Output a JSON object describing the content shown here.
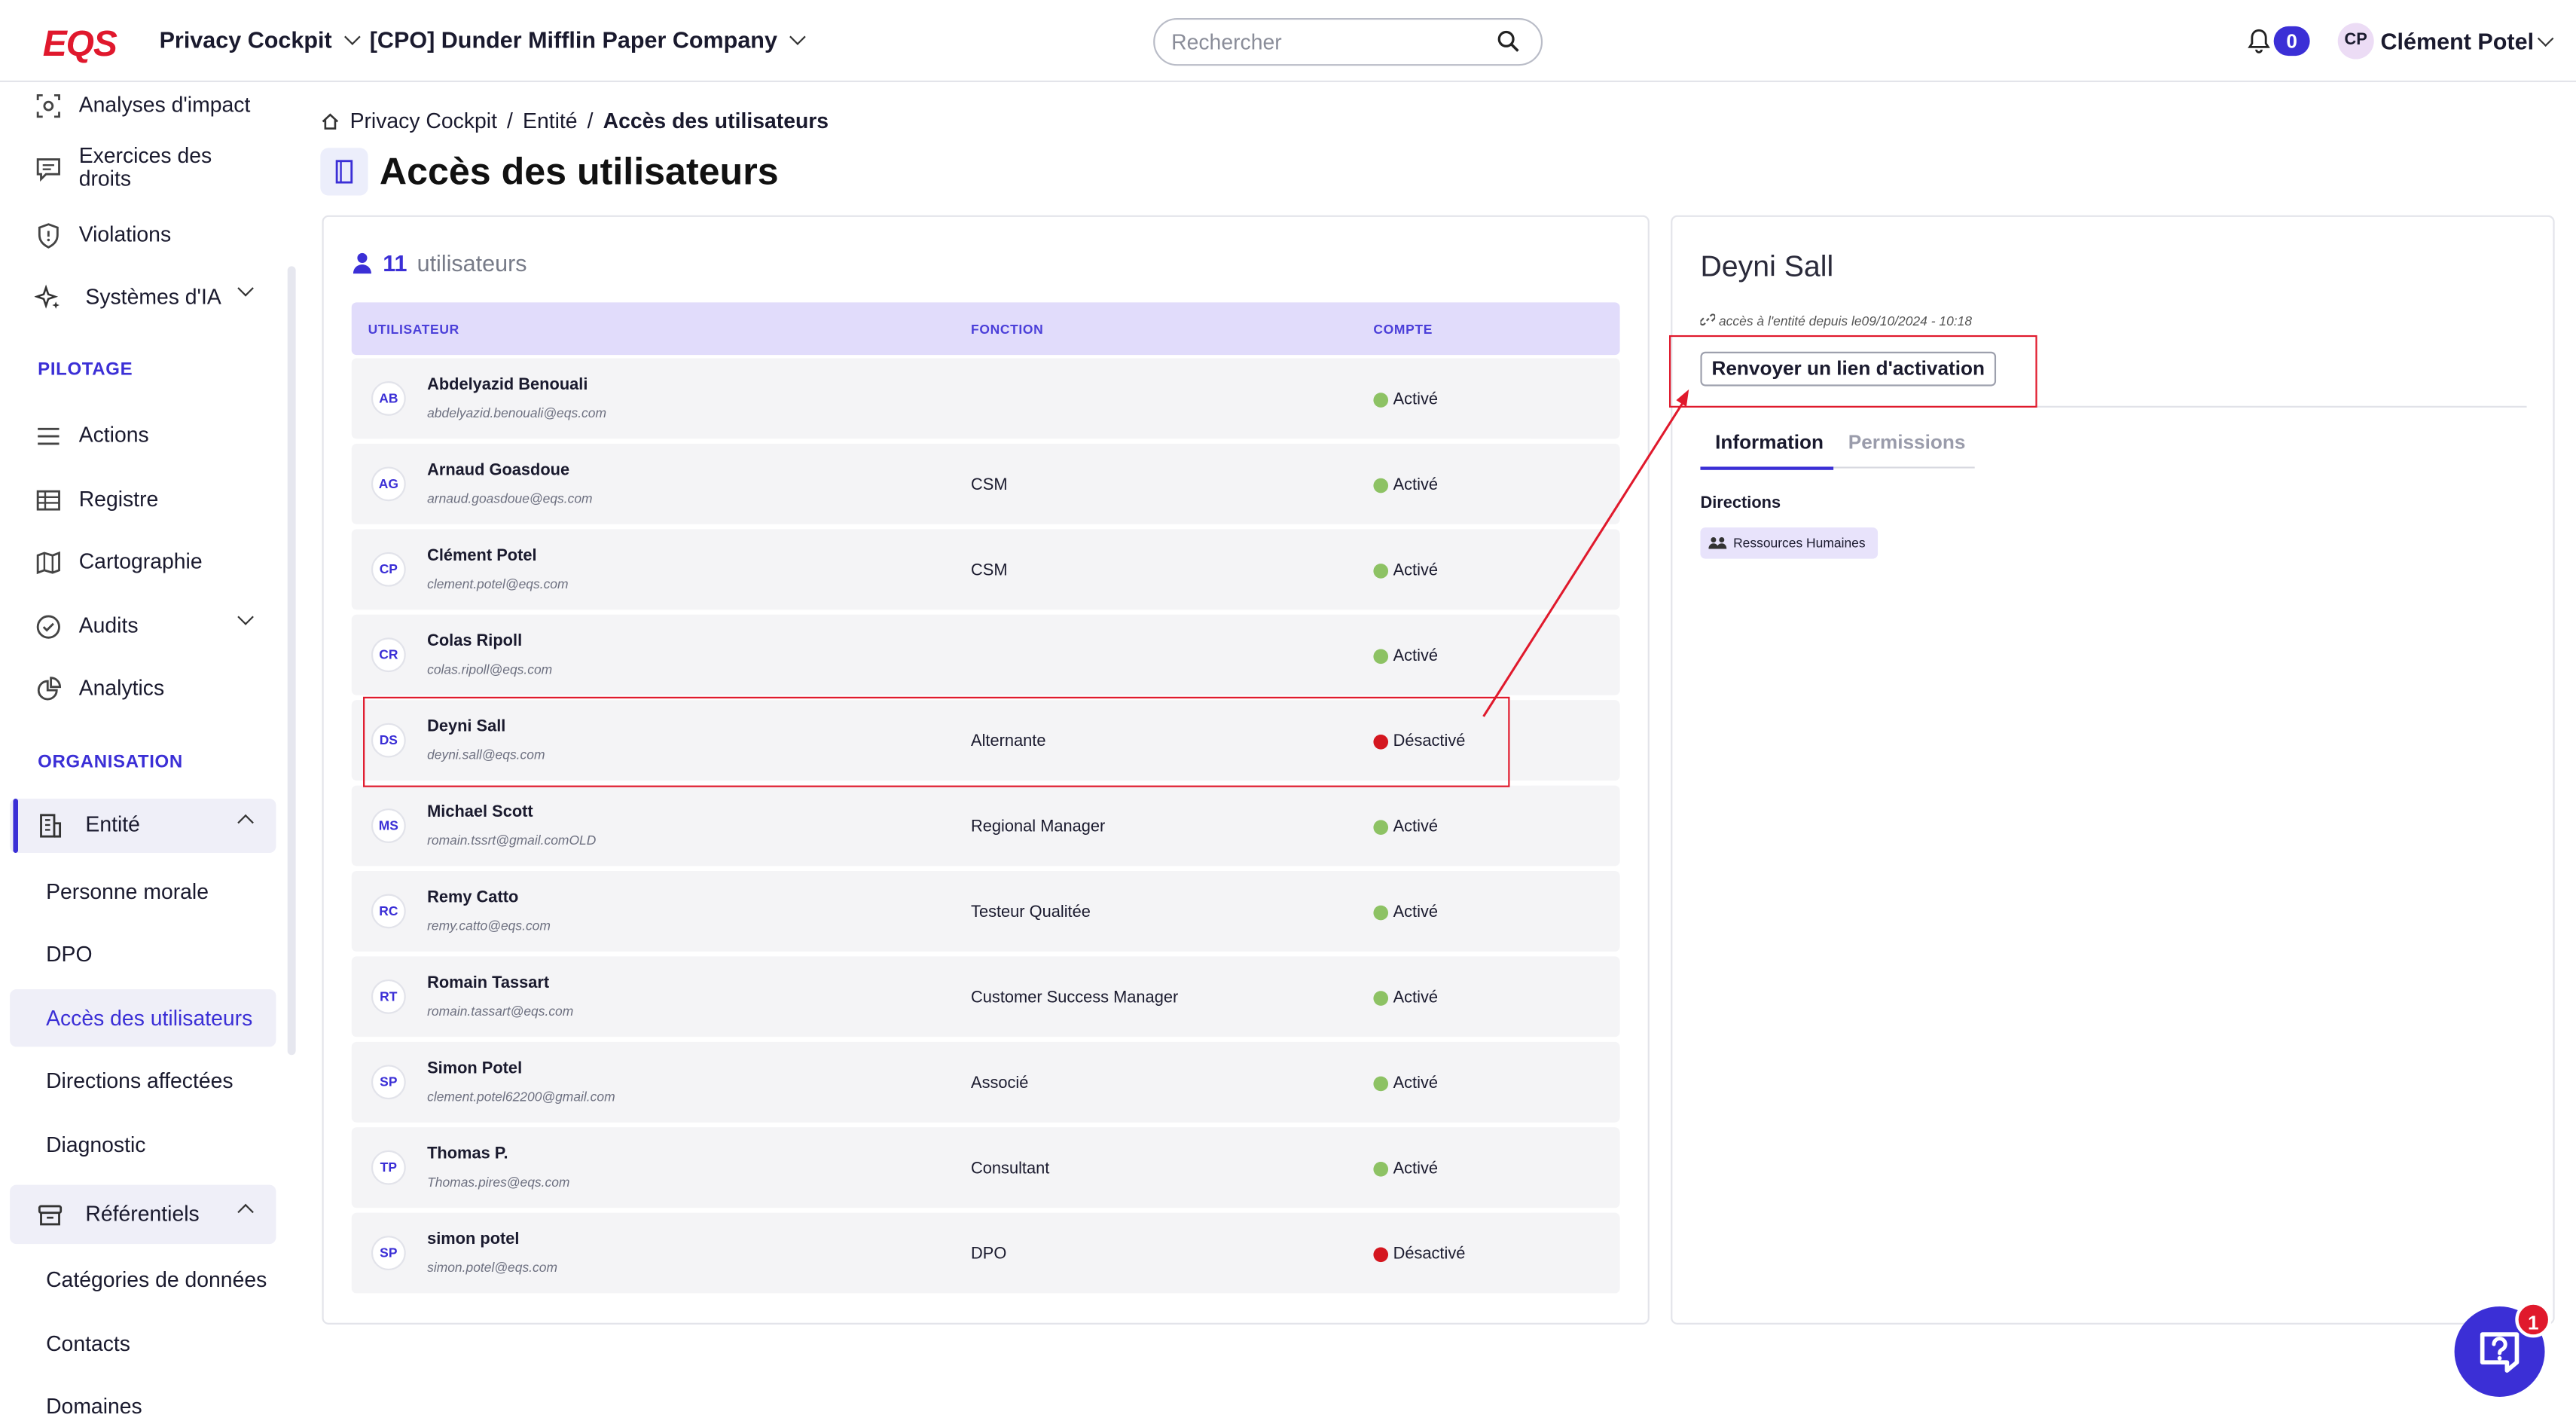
{
  "header": {
    "logo": "EQS",
    "app_menu": "Privacy Cockpit",
    "company_menu": "[CPO] Dunder Mifflin Paper Company",
    "search_placeholder": "Rechercher",
    "notifications_count": "0",
    "user_initials": "CP",
    "user_name": "Clément Potel"
  },
  "sidebar": {
    "top_items": [
      {
        "label": "Analyses d'impact",
        "icon": "impact-analysis-icon"
      },
      {
        "label": "Exercices des droits",
        "icon": "rights-chat-icon"
      },
      {
        "label": "Violations",
        "icon": "shield-icon"
      },
      {
        "label": "Systèmes d'IA",
        "icon": "ai-sparkle-icon"
      }
    ],
    "section_pilotage": "PILOTAGE",
    "pilotage_items": [
      {
        "label": "Actions",
        "icon": "list-icon"
      },
      {
        "label": "Registre",
        "icon": "table-icon"
      },
      {
        "label": "Cartographie",
        "icon": "map-icon"
      },
      {
        "label": "Audits",
        "icon": "check-circle-icon"
      },
      {
        "label": "Analytics",
        "icon": "pie-chart-icon"
      }
    ],
    "section_organisation": "ORGANISATION",
    "entite_label": "Entité",
    "entite_sub": [
      "Personne morale",
      "DPO",
      "Accès des utilisateurs",
      "Directions affectées",
      "Diagnostic"
    ],
    "referentiels_label": "Référentiels",
    "referentiels_sub": [
      "Catégories de données",
      "Contacts",
      "Domaines"
    ]
  },
  "breadcrumb": {
    "home": "Privacy Cockpit",
    "level2": "Entité",
    "current": "Accès des utilisateurs"
  },
  "page_title": "Accès des utilisateurs",
  "users_panel": {
    "count": "11",
    "count_label": "utilisateurs",
    "columns": [
      "UTILISATEUR",
      "FONCTION",
      "COMPTE"
    ],
    "rows": [
      {
        "initials": "AB",
        "name": "Abdelyazid Benouali",
        "email": "abdelyazid.benouali@eqs.com",
        "function": "",
        "status": "Activé",
        "status_color": "#8dc264"
      },
      {
        "initials": "AG",
        "name": "Arnaud Goasdoue",
        "email": "arnaud.goasdoue@eqs.com",
        "function": "CSM",
        "status": "Activé",
        "status_color": "#8dc264"
      },
      {
        "initials": "CP",
        "name": "Clément Potel",
        "email": "clement.potel@eqs.com",
        "function": "CSM",
        "status": "Activé",
        "status_color": "#8dc264"
      },
      {
        "initials": "CR",
        "name": "Colas Ripoll",
        "email": "colas.ripoll@eqs.com",
        "function": "",
        "status": "Activé",
        "status_color": "#8dc264"
      },
      {
        "initials": "DS",
        "name": "Deyni Sall",
        "email": "deyni.sall@eqs.com",
        "function": "Alternante",
        "status": "Désactivé",
        "status_color": "#d4161f"
      },
      {
        "initials": "MS",
        "name": "Michael Scott",
        "email": "romain.tssrt@gmail.comOLD",
        "function": "Regional Manager",
        "status": "Activé",
        "status_color": "#8dc264"
      },
      {
        "initials": "RC",
        "name": "Remy Catto",
        "email": "remy.catto@eqs.com",
        "function": "Testeur Qualitée",
        "status": "Activé",
        "status_color": "#8dc264"
      },
      {
        "initials": "RT",
        "name": "Romain Tassart",
        "email": "romain.tassart@eqs.com",
        "function": "Customer Success Manager",
        "status": "Activé",
        "status_color": "#8dc264"
      },
      {
        "initials": "SP",
        "name": "Simon Potel",
        "email": "clement.potel62200@gmail.com",
        "function": "Associé",
        "status": "Activé",
        "status_color": "#8dc264"
      },
      {
        "initials": "TP",
        "name": "Thomas P.",
        "email": "Thomas.pires@eqs.com",
        "function": "Consultant",
        "status": "Activé",
        "status_color": "#8dc264"
      },
      {
        "initials": "SP",
        "name": "simon potel",
        "email": "simon.potel@eqs.com",
        "function": "DPO",
        "status": "Désactivé",
        "status_color": "#d4161f"
      }
    ]
  },
  "detail": {
    "name": "Deyni Sall",
    "since": "accès à l'entité depuis le09/10/2024 - 10:18",
    "resend_button": "Renvoyer un lien d'activation",
    "tabs": [
      "Information",
      "Permissions"
    ],
    "directions_label": "Directions",
    "directions": [
      "Ressources Humaines"
    ]
  },
  "help_badge": "1",
  "colors": {
    "accent": "#3b2fd6",
    "brand_red": "#e0182d",
    "annotation_red": "#e0192c"
  }
}
